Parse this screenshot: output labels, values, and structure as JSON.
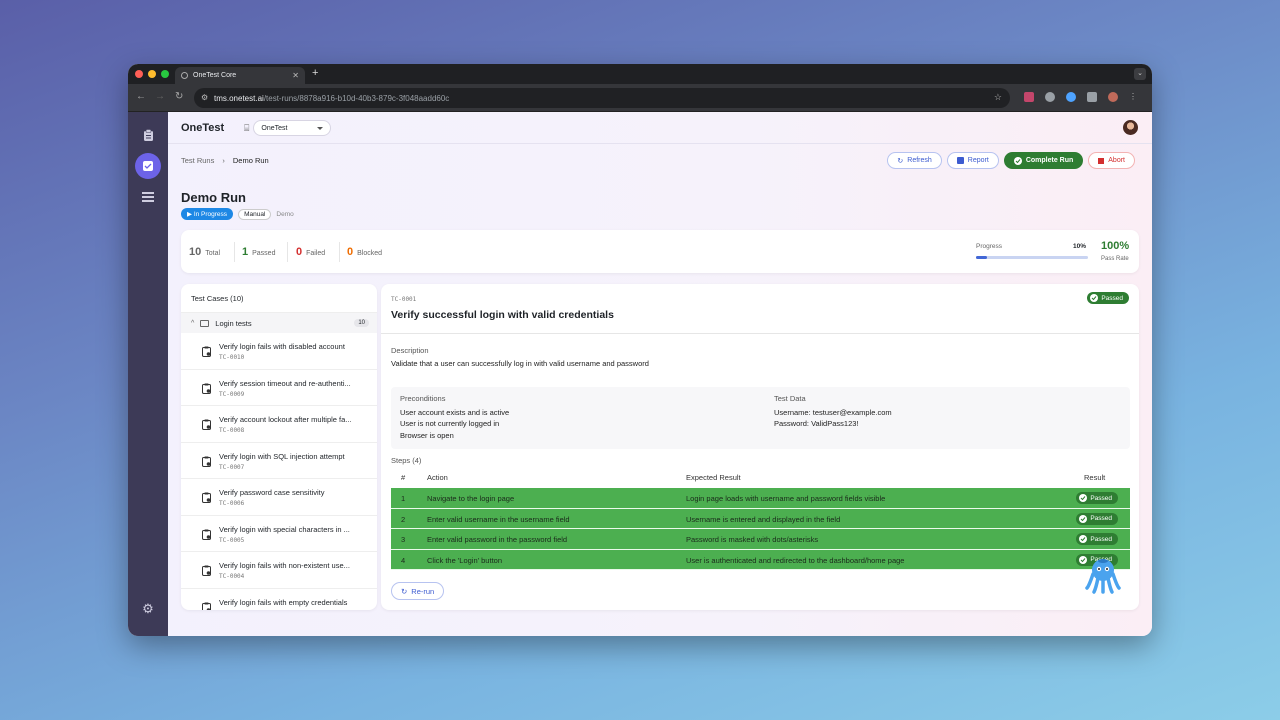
{
  "browser": {
    "tab_title": "OneTest Core",
    "url_host": "tms.onetest.ai",
    "url_path": "/test-runs/8878a916-b10d-40b3-879c-3f048aadd60c"
  },
  "app": {
    "logo": "OneTest",
    "project_select": "OneTest"
  },
  "breadcrumb": {
    "root": "Test Runs",
    "current": "Demo Run"
  },
  "actions": {
    "refresh": "Refresh",
    "report": "Report",
    "complete": "Complete Run",
    "abort": "Abort"
  },
  "run": {
    "title": "Demo Run",
    "status": "In Progress",
    "type": "Manual",
    "env": "Demo"
  },
  "stats": {
    "total": {
      "value": "10",
      "label": "Total"
    },
    "passed": {
      "value": "1",
      "label": "Passed"
    },
    "failed": {
      "value": "0",
      "label": "Failed"
    },
    "blocked": {
      "value": "0",
      "label": "Blocked"
    },
    "progress_label": "Progress",
    "progress_value": "10%",
    "progress_fraction": 0.1,
    "pass_rate_value": "100%",
    "pass_rate_label": "Pass Rate"
  },
  "test_list": {
    "header": "Test Cases (10)",
    "folder": {
      "name": "Login tests",
      "count": "10"
    },
    "items": [
      {
        "title": "Verify login fails with disabled account",
        "id": "TC-0010"
      },
      {
        "title": "Verify session timeout and re-authenti...",
        "id": "TC-0009"
      },
      {
        "title": "Verify account lockout after multiple fa...",
        "id": "TC-0008"
      },
      {
        "title": "Verify login with SQL injection attempt",
        "id": "TC-0007"
      },
      {
        "title": "Verify password case sensitivity",
        "id": "TC-0006"
      },
      {
        "title": "Verify login with special characters in ...",
        "id": "TC-0005"
      },
      {
        "title": "Verify login fails with non-existent use...",
        "id": "TC-0004"
      },
      {
        "title": "Verify login fails with empty credentials",
        "id": "TC-0003"
      }
    ]
  },
  "detail": {
    "id": "TC-0001",
    "title": "Verify successful login with valid credentials",
    "status": "Passed",
    "description_label": "Description",
    "description": "Validate that a user can successfully log in with valid username and password",
    "preconditions_label": "Preconditions",
    "preconditions": [
      "User account exists and is active",
      "User is not currently logged in",
      "Browser is open"
    ],
    "test_data_label": "Test Data",
    "test_data": [
      "Username: testuser@example.com",
      "Password: ValidPass123!"
    ],
    "steps_label": "Steps (4)",
    "steps_headers": {
      "num": "#",
      "action": "Action",
      "expected": "Expected Result",
      "result": "Result"
    },
    "steps": [
      {
        "num": "1",
        "action": "Navigate to the login page",
        "expected": "Login page loads with username and password fields visible",
        "result": "Passed"
      },
      {
        "num": "2",
        "action": "Enter valid username in the username field",
        "expected": "Username is entered and displayed in the field",
        "result": "Passed"
      },
      {
        "num": "3",
        "action": "Enter valid password in the password field",
        "expected": "Password is masked with dots/asterisks",
        "result": "Passed"
      },
      {
        "num": "4",
        "action": "Click the 'Login' button",
        "expected": "User is authenticated and redirected to the dashboard/home page",
        "result": "Passed"
      }
    ],
    "rerun_label": "Re-run"
  }
}
